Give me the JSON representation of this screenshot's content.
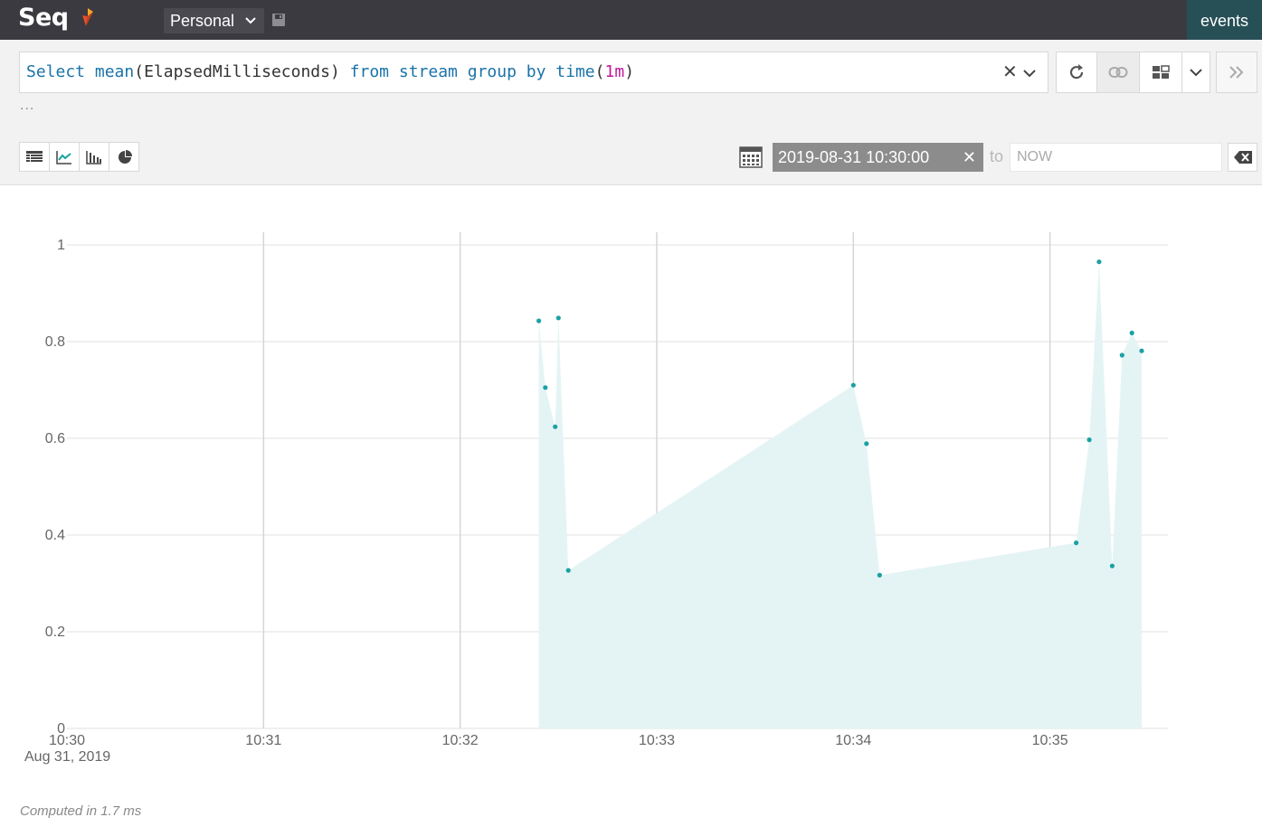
{
  "header": {
    "logo_text": "Seq",
    "workspace": "Personal",
    "events_tab": "events"
  },
  "query": {
    "tokens": [
      {
        "text": "Select",
        "kind": "kw"
      },
      {
        "text": " ",
        "kind": "plain"
      },
      {
        "text": "mean",
        "kind": "fn"
      },
      {
        "text": "(ElapsedMilliseconds) ",
        "kind": "plain"
      },
      {
        "text": "from",
        "kind": "kw"
      },
      {
        "text": " ",
        "kind": "plain"
      },
      {
        "text": "stream",
        "kind": "kw"
      },
      {
        "text": " ",
        "kind": "plain"
      },
      {
        "text": "group",
        "kind": "kw"
      },
      {
        "text": " ",
        "kind": "plain"
      },
      {
        "text": "by",
        "kind": "kw"
      },
      {
        "text": " ",
        "kind": "plain"
      },
      {
        "text": "time",
        "kind": "fn"
      },
      {
        "text": "(",
        "kind": "plain"
      },
      {
        "text": "1m",
        "kind": "num"
      },
      {
        "text": ")",
        "kind": "plain"
      }
    ],
    "more_indicator": "...",
    "clear_glyph": "✕"
  },
  "range": {
    "from": "2019-08-31 10:30:00",
    "clear_glyph": "✕",
    "to_label": "to",
    "to_placeholder": "NOW"
  },
  "colors": {
    "accent": "#1aa1a3",
    "area_fill": "#e4f4f4",
    "header_bg": "#3b3a40",
    "events_tab_bg": "#274f56"
  },
  "icons": [
    "save-icon",
    "refresh-icon",
    "link-icon",
    "dashboard-icon",
    "chevron-down-icon",
    "double-chevron-right-icon",
    "table-icon",
    "line-chart-icon",
    "bar-chart-icon",
    "pie-chart-icon",
    "calendar-icon",
    "backspace-icon"
  ],
  "chart_data": {
    "type": "area",
    "x_ticks": [
      "10:30",
      "10:31",
      "10:32",
      "10:33",
      "10:34",
      "10:35"
    ],
    "x_start_date": "Aug 31, 2019",
    "y_ticks": [
      "0",
      "0.2",
      "0.4",
      "0.6",
      "0.8",
      "1"
    ],
    "ylim": [
      0,
      1
    ],
    "xlim": [
      "10:30:00",
      "10:35:36"
    ],
    "grid": true,
    "series": [
      {
        "points": [
          {
            "x": "10:32:24",
            "y": 0.843
          },
          {
            "x": "10:32:26",
            "y": 0.705
          },
          {
            "x": "10:32:29",
            "y": 0.624
          },
          {
            "x": "10:32:30",
            "y": 0.849
          },
          {
            "x": "10:32:33",
            "y": 0.327
          },
          {
            "x": "10:34:00",
            "y": 0.71
          },
          {
            "x": "10:34:04",
            "y": 0.589
          },
          {
            "x": "10:34:08",
            "y": 0.317
          },
          {
            "x": "10:35:08",
            "y": 0.384
          },
          {
            "x": "10:35:12",
            "y": 0.597
          },
          {
            "x": "10:35:15",
            "y": 0.965
          },
          {
            "x": "10:35:19",
            "y": 0.336
          },
          {
            "x": "10:35:22",
            "y": 0.772
          },
          {
            "x": "10:35:25",
            "y": 0.818
          },
          {
            "x": "10:35:28",
            "y": 0.781
          }
        ]
      }
    ]
  },
  "footer": {
    "computed": "Computed in 1.7 ms"
  }
}
